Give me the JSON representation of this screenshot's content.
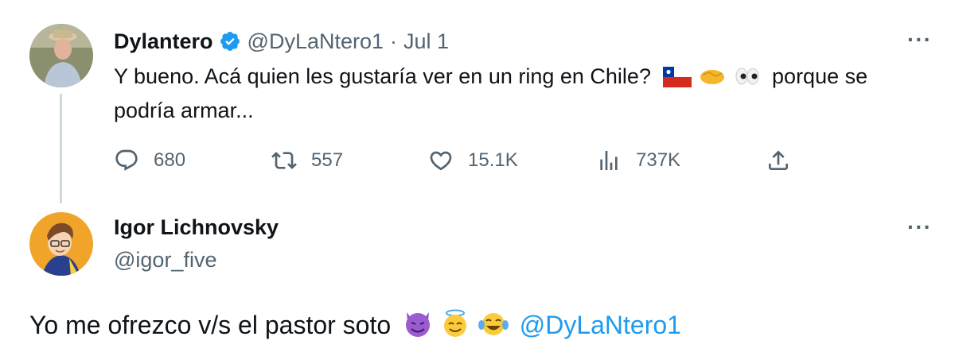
{
  "tweet1": {
    "author_name": "Dylantero",
    "verified": true,
    "handle": "@DyLaNtero1",
    "separator": "·",
    "date": "Jul 1",
    "text_line1": "Y bueno. Acá quien les gustaría ver en un ring en Chile?",
    "text_tail": "porque se",
    "text_line2": "podría armar...",
    "more_label": "···",
    "stats": {
      "replies": "680",
      "retweets": "557",
      "likes": "15.1K",
      "views": "737K"
    }
  },
  "tweet2": {
    "author_name": "Igor Lichnovsky",
    "handle": "@igor_five",
    "more_label": "···",
    "text": "Yo me ofrezco v/s el pastor soto",
    "mention": "@DyLaNtero1"
  },
  "colors": {
    "accent": "#1d9bf0",
    "muted": "#536471",
    "text": "#0f1419",
    "thread_line": "#cfd9de"
  },
  "icons": [
    "verified-badge-icon",
    "chile-flag-emoji",
    "handshake-emoji",
    "eyes-emoji",
    "reply-icon",
    "retweet-icon",
    "like-icon",
    "views-icon",
    "share-icon",
    "smiling-devil-emoji",
    "halo-emoji",
    "tears-of-joy-emoji"
  ]
}
